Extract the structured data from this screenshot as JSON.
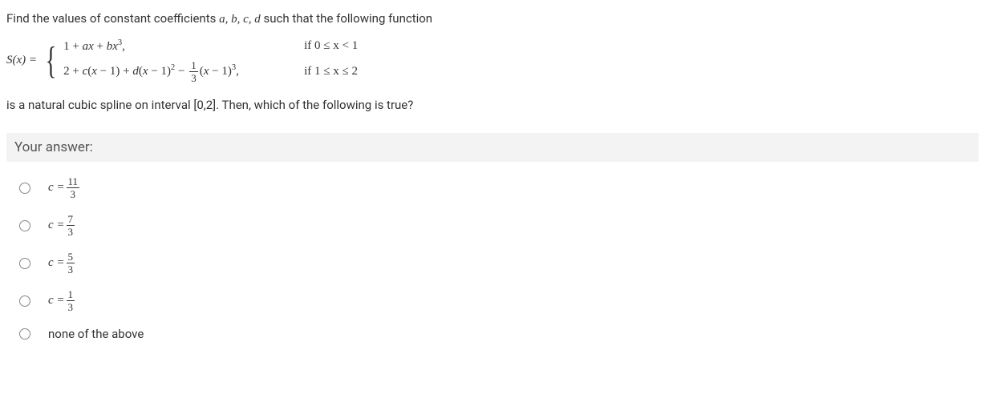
{
  "question": {
    "intro_prefix": "Find the values of constant coefficients ",
    "vars": "a, b, c, d",
    "intro_suffix": " such that the following function",
    "sx_label": "S(x) = ",
    "piece1_expr": "1 + ax + bx³,",
    "piece1_cond": "if  0 ≤ x < 1",
    "piece2_expr_pre": "2 + c(x − 1) + d(x − 1)² − ",
    "piece2_frac_num": "1",
    "piece2_frac_den": "3",
    "piece2_expr_post": "(x − 1)³,",
    "piece2_cond": "if  1 ≤ x ≤ 2",
    "closing": "is a natural cubic spline on interval [0,2]. Then, which of the following is true?"
  },
  "answer_header": "Your answer:",
  "options": [
    {
      "type": "frac",
      "prefix": "c = ",
      "num": "11",
      "den": "3"
    },
    {
      "type": "frac",
      "prefix": "c = ",
      "num": "7",
      "den": "3"
    },
    {
      "type": "frac",
      "prefix": "c = ",
      "num": "5",
      "den": "3"
    },
    {
      "type": "frac",
      "prefix": "c = ",
      "num": "1",
      "den": "3"
    },
    {
      "type": "plain",
      "text": "none of the above"
    }
  ]
}
